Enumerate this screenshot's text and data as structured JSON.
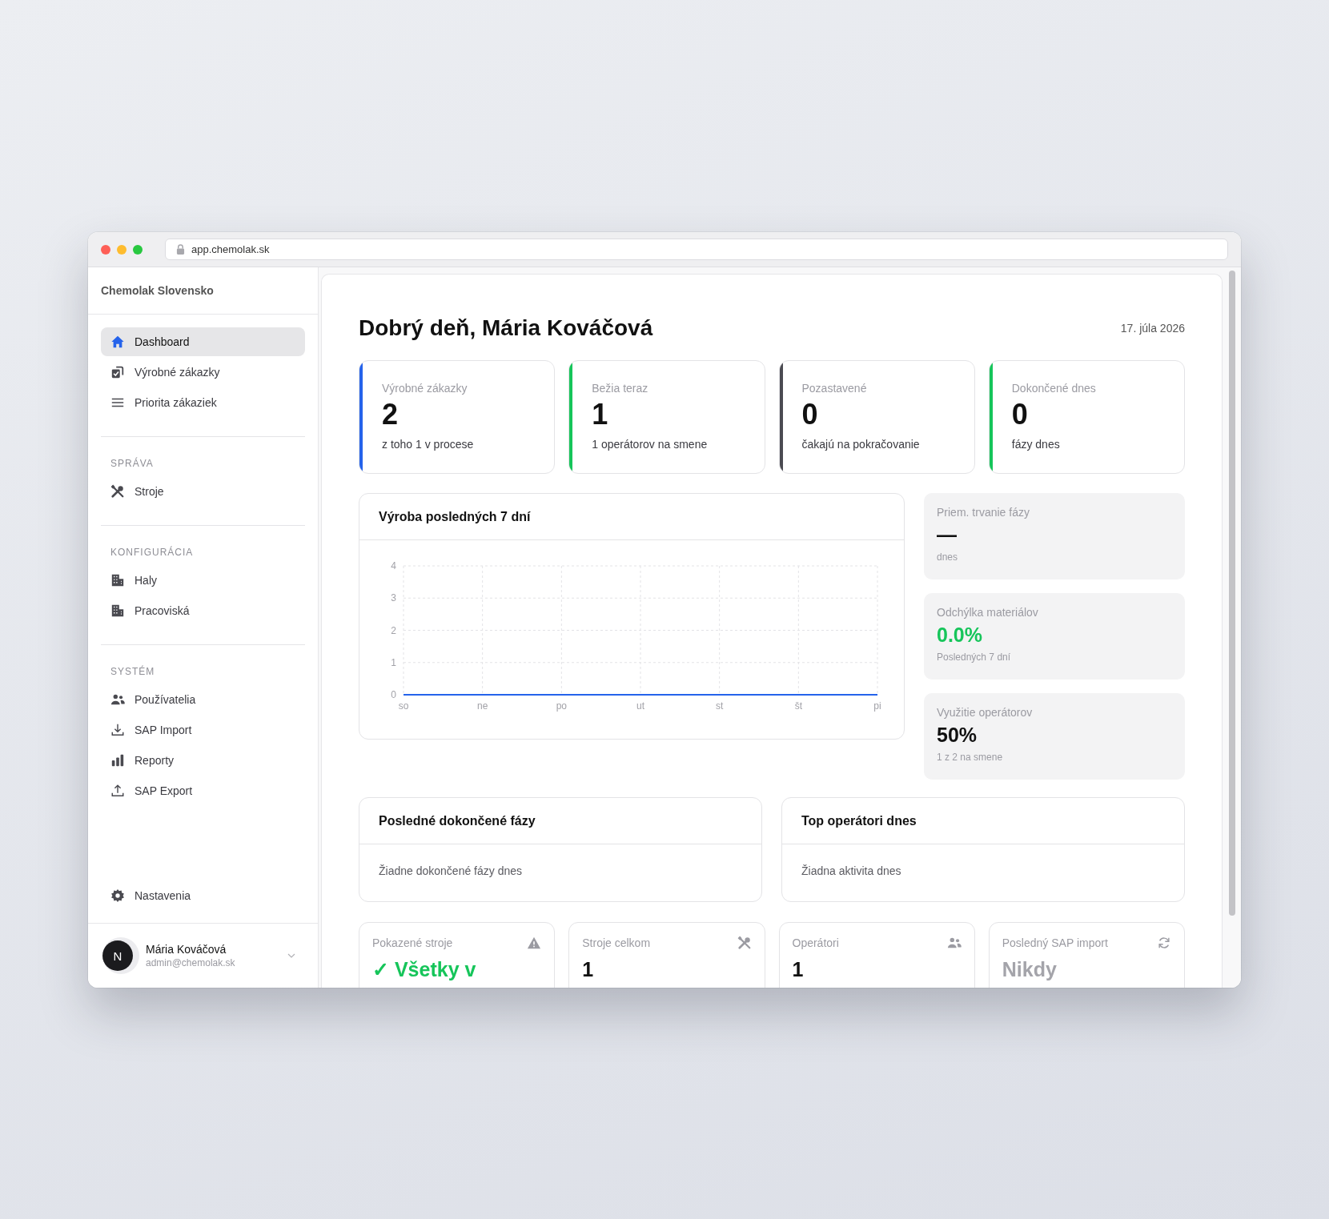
{
  "browser": {
    "url": "app.chemolak.sk"
  },
  "sidebar": {
    "brand": "Chemolak Slovensko",
    "nav": [
      {
        "label": "Dashboard",
        "selected": true
      },
      {
        "label": "Výrobné zákazky",
        "selected": false
      },
      {
        "label": "Priorita zákaziek",
        "selected": false
      }
    ],
    "sections": [
      {
        "heading": "SPRÁVA",
        "items": [
          {
            "label": "Stroje",
            "selected": false
          }
        ]
      },
      {
        "heading": "KONFIGURÁCIA",
        "items": [
          {
            "label": "Haly",
            "selected": false
          },
          {
            "label": "Pracoviská",
            "selected": false
          }
        ]
      },
      {
        "heading": "SYSTÉM",
        "items": [
          {
            "label": "Používatelia",
            "selected": false
          },
          {
            "label": "SAP Import",
            "selected": false
          },
          {
            "label": "Reporty",
            "selected": false
          },
          {
            "label": "SAP Export",
            "selected": false
          }
        ]
      }
    ],
    "settings": {
      "label": "Nastavenia",
      "selected": false
    },
    "user": {
      "initial": "N",
      "name": "Mária Kováčová",
      "email": "admin@chemolak.sk"
    }
  },
  "header": {
    "greeting": "Dobrý deň, Mária Kováčová",
    "date": "17. júla 2026"
  },
  "stat_cards": [
    {
      "label": "Výrobné zákazky",
      "value": "2",
      "note": "z toho 1 v procese",
      "color": "#2563eb"
    },
    {
      "label": "Bežia teraz",
      "value": "1",
      "note": "1 operátorov na smene",
      "color": "#16c55a"
    },
    {
      "label": "Pozastavené",
      "value": "0",
      "note": "čakajú na pokračovanie",
      "color": "#4b4b52"
    },
    {
      "label": "Dokončené dnes",
      "value": "0",
      "note": "fázy dnes",
      "color": "#16c55a"
    }
  ],
  "production_chart": {
    "title": "Výroba posledných 7 dní",
    "chart_data": {
      "type": "line",
      "categories": [
        "so",
        "ne",
        "po",
        "ut",
        "st",
        "št",
        "pi"
      ],
      "series": [
        {
          "color": "#2563eb",
          "values": [
            0,
            0,
            0,
            0,
            0,
            0,
            0
          ]
        }
      ],
      "ylim": [
        0,
        4
      ],
      "yticks": [
        0,
        1,
        2,
        3,
        4
      ],
      "grid": true
    }
  },
  "metrics": [
    {
      "label": "Priem. trvanie fázy",
      "value": "—",
      "note": "dnes",
      "color": "#111111"
    },
    {
      "label": "Odchýlka materiálov",
      "value": "0.0%",
      "note": "Posledných 7 dní",
      "color": "#16c55a"
    },
    {
      "label": "Využitie operátorov",
      "value": "50%",
      "note": "1 z 2 na smene",
      "color": "#111111"
    }
  ],
  "lists": [
    {
      "title": "Posledné dokončené fázy",
      "empty": "Žiadne dokončené fázy dnes"
    },
    {
      "title": "Top operátori dnes",
      "empty": "Žiadna aktivita dnes"
    }
  ],
  "summary_cards": [
    {
      "label": "Pokazené stroje",
      "value": "✓ Všetky v",
      "color": "#16c55a"
    },
    {
      "label": "Stroje celkom",
      "value": "1",
      "color": "#111111"
    },
    {
      "label": "Operátori",
      "value": "1",
      "color": "#111111"
    },
    {
      "label": "Posledný SAP import",
      "value": "Nikdy",
      "color": "#a4a4aa"
    }
  ]
}
